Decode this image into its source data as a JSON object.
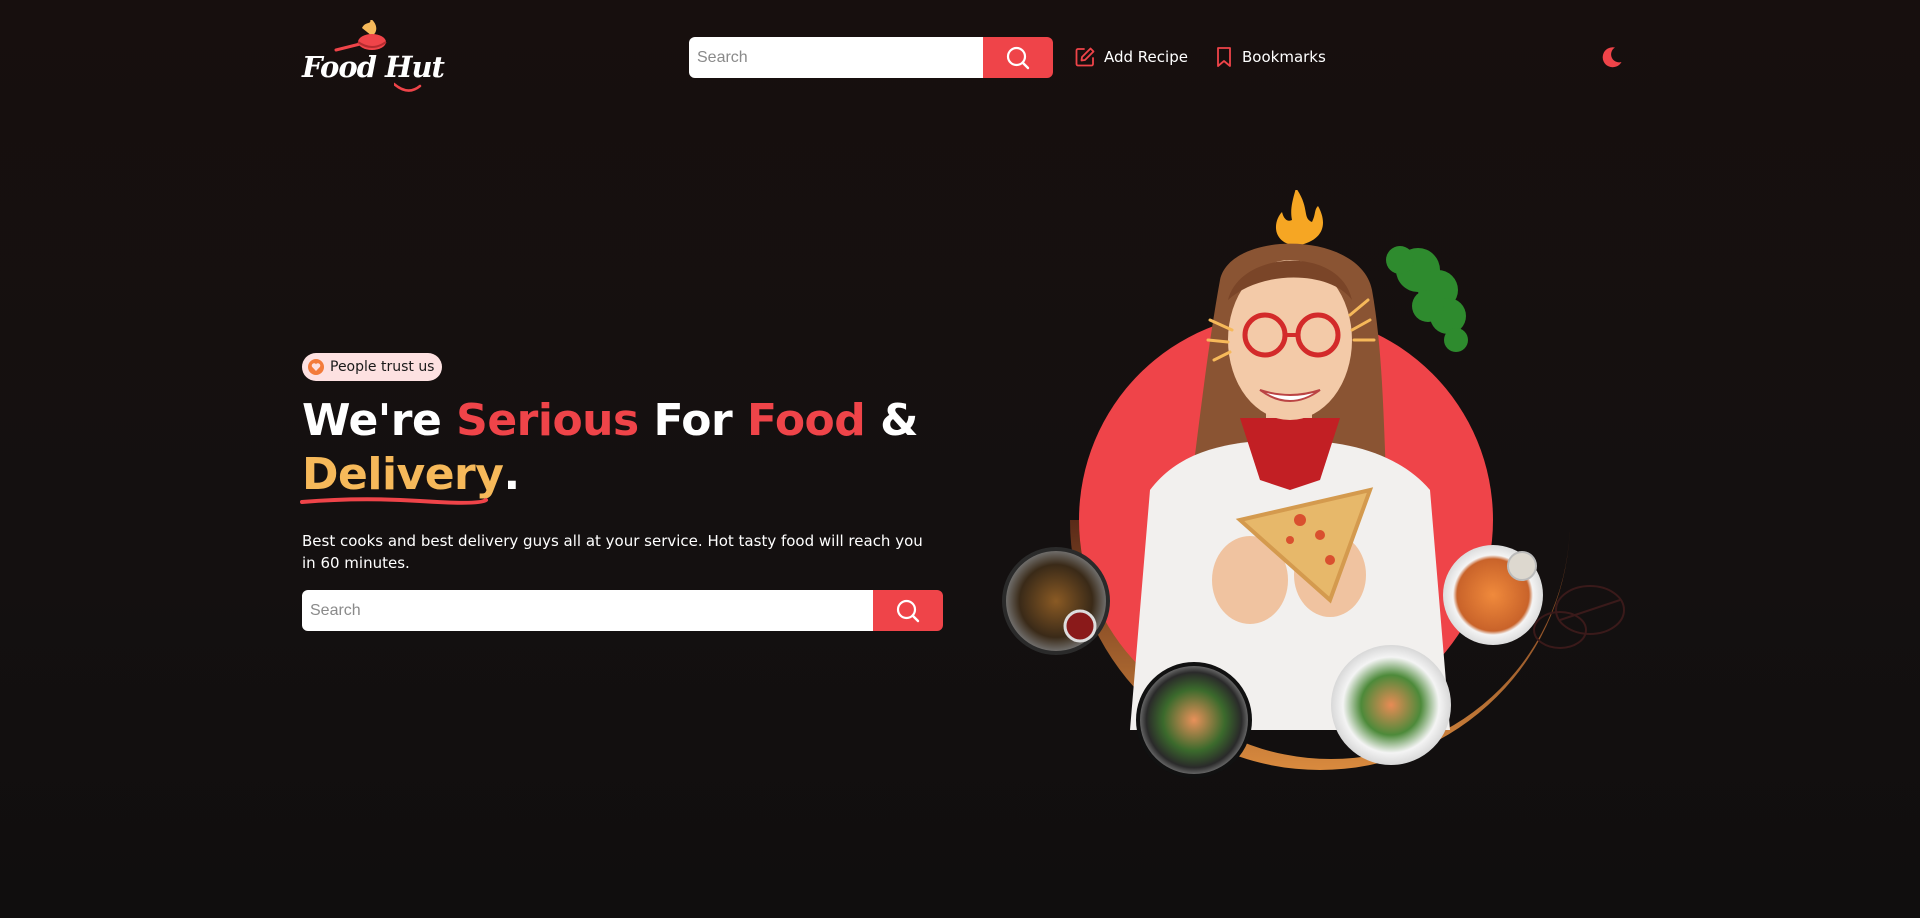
{
  "brand": {
    "name": "Food Hut"
  },
  "header": {
    "search_placeholder": "Search",
    "nav": {
      "add_recipe": "Add Recipe",
      "bookmarks": "Bookmarks"
    }
  },
  "hero": {
    "badge": "People trust us",
    "headline": {
      "part1": "We're ",
      "part2": "Serious",
      "part3": " For ",
      "part4": "Food",
      "part5": " & ",
      "part6": "Delivery",
      "part7": "."
    },
    "description": "Best cooks and best delivery guys all at your service. Hot tasty food will reach you in 60 minutes.",
    "search_placeholder": "Search"
  },
  "colors": {
    "accent": "#ef4449",
    "gold": "#f6b95a",
    "background": "#150f0e",
    "badge_bg": "#fde1e1"
  },
  "icons": {
    "search": "search-icon",
    "add_recipe": "edit-icon",
    "bookmarks": "bookmark-icon",
    "theme": "moon-icon",
    "badge": "heart-shield-icon"
  }
}
